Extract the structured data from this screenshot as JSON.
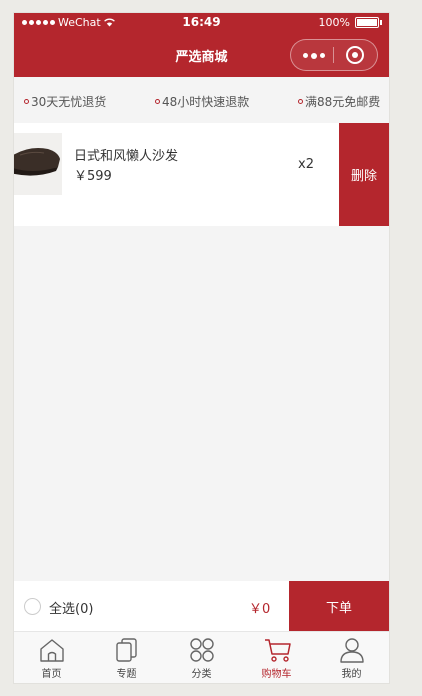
{
  "colors": {
    "brand": "#b4262d",
    "page_bg": "#f4f4f4",
    "text": "#333333"
  },
  "status_bar": {
    "carrier": "WeChat",
    "time": "16:49",
    "battery": "100%"
  },
  "navbar": {
    "title": "严选商城",
    "icons": [
      "more-icon",
      "target-icon"
    ]
  },
  "services": [
    {
      "label": "30天无忧退货"
    },
    {
      "label": "48小时快速退款"
    },
    {
      "label": "满88元免邮费"
    }
  ],
  "cart": {
    "items": [
      {
        "name": "日式和风懒人沙发",
        "price": "￥599",
        "quantity": "x2",
        "delete_label": "删除"
      }
    ]
  },
  "checkout": {
    "select_all_label": "全选(0)",
    "total": "￥0",
    "order_label": "下单"
  },
  "tabbar": {
    "active_index": 3,
    "items": [
      {
        "label": "首页",
        "icon": "home-icon"
      },
      {
        "label": "专题",
        "icon": "topics-icon"
      },
      {
        "label": "分类",
        "icon": "category-icon"
      },
      {
        "label": "购物车",
        "icon": "cart-icon"
      },
      {
        "label": "我的",
        "icon": "profile-icon"
      }
    ]
  }
}
